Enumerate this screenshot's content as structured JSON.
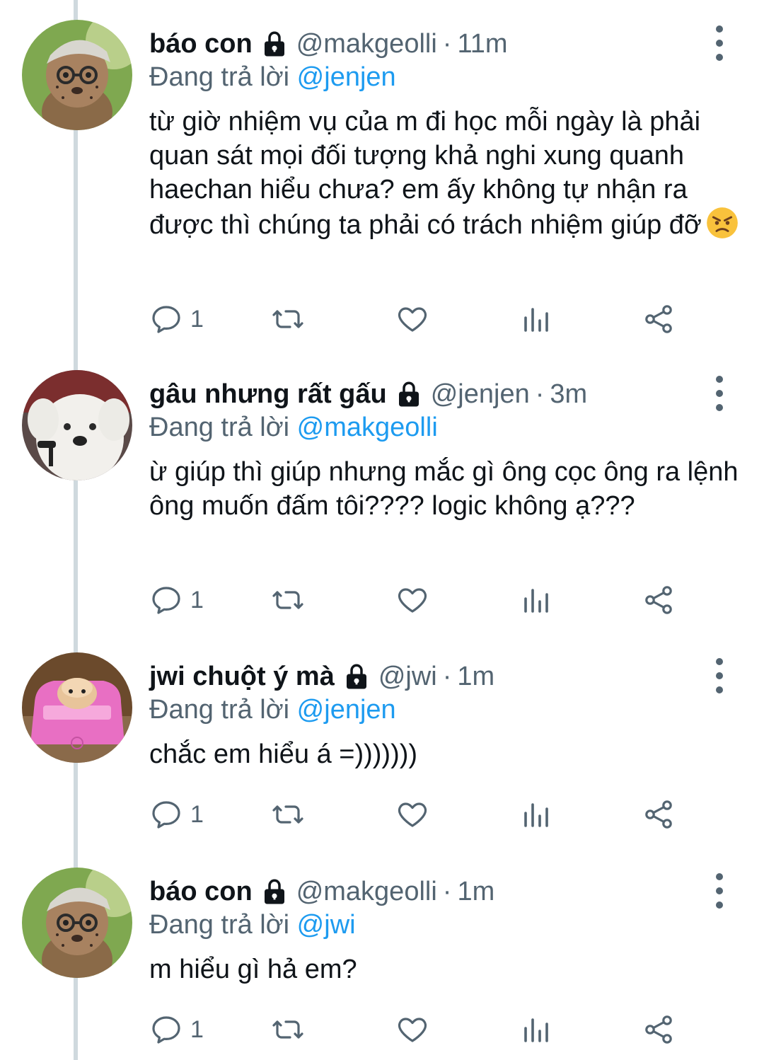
{
  "colors": {
    "text": "#0f1419",
    "secondary": "#536471",
    "mention": "#1d9bf0",
    "thread_line": "#cfd9de"
  },
  "tweets": [
    {
      "name": "báo con",
      "handle": "@makgeolli",
      "separator": "·",
      "time": "11m",
      "reply_prefix": "Đang trả lời",
      "reply_to": "@jenjen",
      "text": "từ giờ nhiệm vụ của m đi học mỗi ngày là phải quan sát mọi đối tượng khả nghi xung quanh haechan hiểu chưa? em ấy không tự nhận ra được thì chúng ta phải có trách nhiệm giúp đỡ",
      "emoji": "angry-face-emoji",
      "reply_count": "1",
      "avatar": "cheetah-cub-avatar"
    },
    {
      "name": "gâu nhưng rất gấu",
      "handle": "@jenjen",
      "separator": "·",
      "time": "3m",
      "reply_prefix": "Đang trả lời",
      "reply_to": "@makgeolli",
      "text": "ừ giúp thì giúp nhưng mắc gì ông cọc ông ra lệnh ông muốn đấm tôi???? logic không ạ???",
      "reply_count": "1",
      "avatar": "white-dog-avatar"
    },
    {
      "name": "jwi chuột ý mà",
      "handle": "@jwi",
      "separator": "·",
      "time": "1m",
      "reply_prefix": "Đang trả lời",
      "reply_to": "@jenjen",
      "text": "chắc em hiểu á =)))))))",
      "reply_count": "1",
      "avatar": "hamster-in-pink-car-avatar"
    },
    {
      "name": "báo con",
      "handle": "@makgeolli",
      "separator": "·",
      "time": "1m",
      "reply_prefix": "Đang trả lời",
      "reply_to": "@jwi",
      "text": "m hiểu gì hả em?",
      "reply_count": "1",
      "avatar": "cheetah-cub-avatar"
    }
  ]
}
